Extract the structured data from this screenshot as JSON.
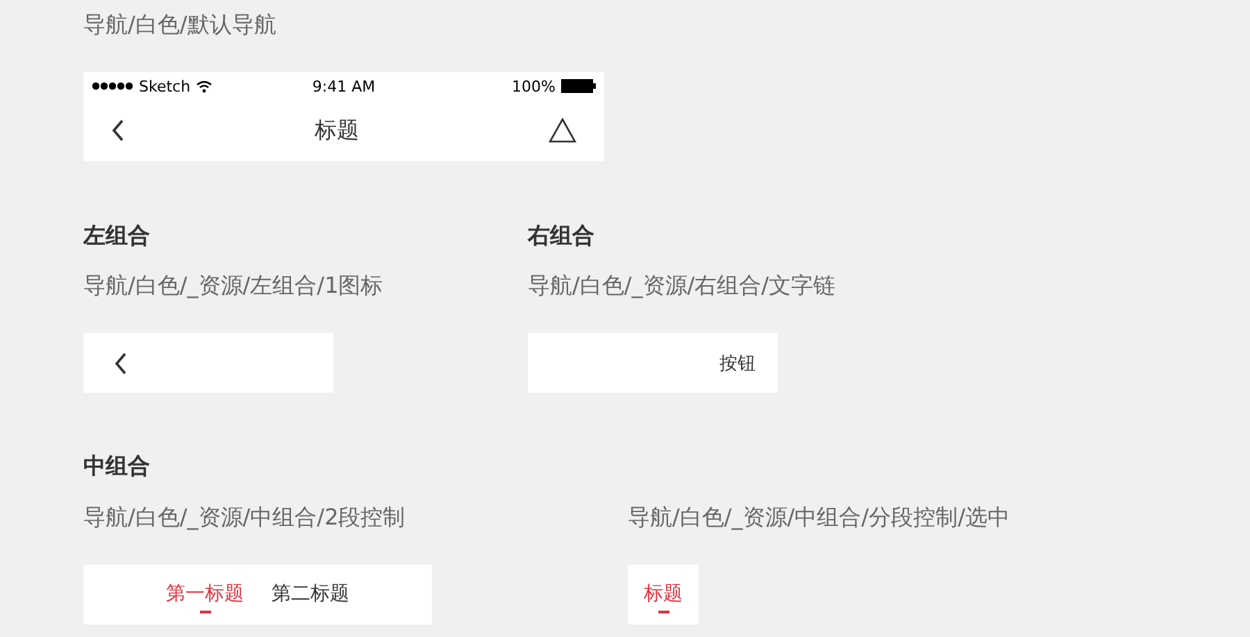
{
  "default_nav": {
    "caption": "导航/白色/默认导航",
    "status_bar": {
      "carrier": "Sketch",
      "time": "9:41 AM",
      "battery": "100%"
    },
    "title": "标题"
  },
  "groups_row": [
    {
      "heading": "左组合",
      "caption": "导航/白色/_资源/左组合/1图标",
      "kind": "back"
    },
    {
      "heading": "右组合",
      "caption": "导航/白色/_资源/右组合/文字链",
      "kind": "link",
      "link": "按钮"
    }
  ],
  "middle": {
    "heading": "中组合",
    "specimens": [
      {
        "caption": "导航/白色/_资源/中组合/2段控制",
        "segments": [
          {
            "label": "第一标题",
            "selected": true
          },
          {
            "label": "第二标题",
            "selected": false
          }
        ]
      },
      {
        "caption": "导航/白色/_资源/中组合/分段控制/选中",
        "segments": [
          {
            "label": "标题",
            "selected": true
          }
        ]
      }
    ]
  }
}
